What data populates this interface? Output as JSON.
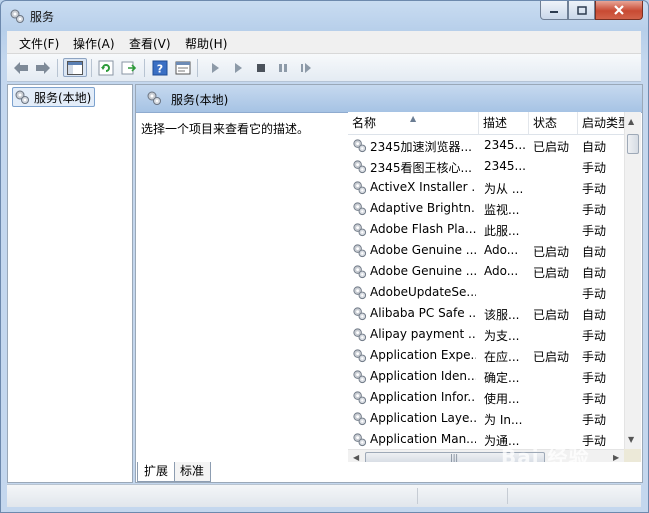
{
  "window": {
    "title": "服务",
    "icon": "services-gear-icon"
  },
  "menu": [
    "文件(F)",
    "操作(A)",
    "查看(V)",
    "帮助(H)"
  ],
  "tree": {
    "node_label": "服务(本地)"
  },
  "right_pane": {
    "header_label": "服务(本地)",
    "description_prompt": "选择一个项目来查看它的描述。"
  },
  "columns": {
    "name": "名称",
    "desc": "描述",
    "status": "状态",
    "startup": "启动类型"
  },
  "rows": [
    {
      "name": "2345加速浏览器...",
      "desc": "2345...",
      "status": "已启动",
      "startup": "自动"
    },
    {
      "name": "2345看图王核心...",
      "desc": "2345...",
      "status": "",
      "startup": "手动"
    },
    {
      "name": "ActiveX Installer ...",
      "desc": "为从 ...",
      "status": "",
      "startup": "手动"
    },
    {
      "name": "Adaptive Brightn...",
      "desc": "监视...",
      "status": "",
      "startup": "手动"
    },
    {
      "name": "Adobe Flash Pla...",
      "desc": "此服...",
      "status": "",
      "startup": "手动"
    },
    {
      "name": "Adobe Genuine ...",
      "desc": "Ado...",
      "status": "已启动",
      "startup": "自动"
    },
    {
      "name": "Adobe Genuine ...",
      "desc": "Ado...",
      "status": "已启动",
      "startup": "自动"
    },
    {
      "name": "AdobeUpdateSe...",
      "desc": "",
      "status": "",
      "startup": "手动"
    },
    {
      "name": "Alibaba PC Safe ...",
      "desc": "该服...",
      "status": "已启动",
      "startup": "自动"
    },
    {
      "name": "Alipay payment ...",
      "desc": "为支...",
      "status": "",
      "startup": "手动"
    },
    {
      "name": "Application Expe...",
      "desc": "在应...",
      "status": "已启动",
      "startup": "手动"
    },
    {
      "name": "Application Iden...",
      "desc": "确定...",
      "status": "",
      "startup": "手动"
    },
    {
      "name": "Application Infor...",
      "desc": "使用...",
      "status": "",
      "startup": "手动"
    },
    {
      "name": "Application Laye...",
      "desc": "为 In...",
      "status": "",
      "startup": "手动"
    },
    {
      "name": "Application Man...",
      "desc": "为通...",
      "status": "",
      "startup": "手动"
    }
  ],
  "tabs": [
    "扩展",
    "标准"
  ],
  "watermark": {
    "brand": "Bai 经验",
    "url": "jingyan.baidu.com"
  }
}
